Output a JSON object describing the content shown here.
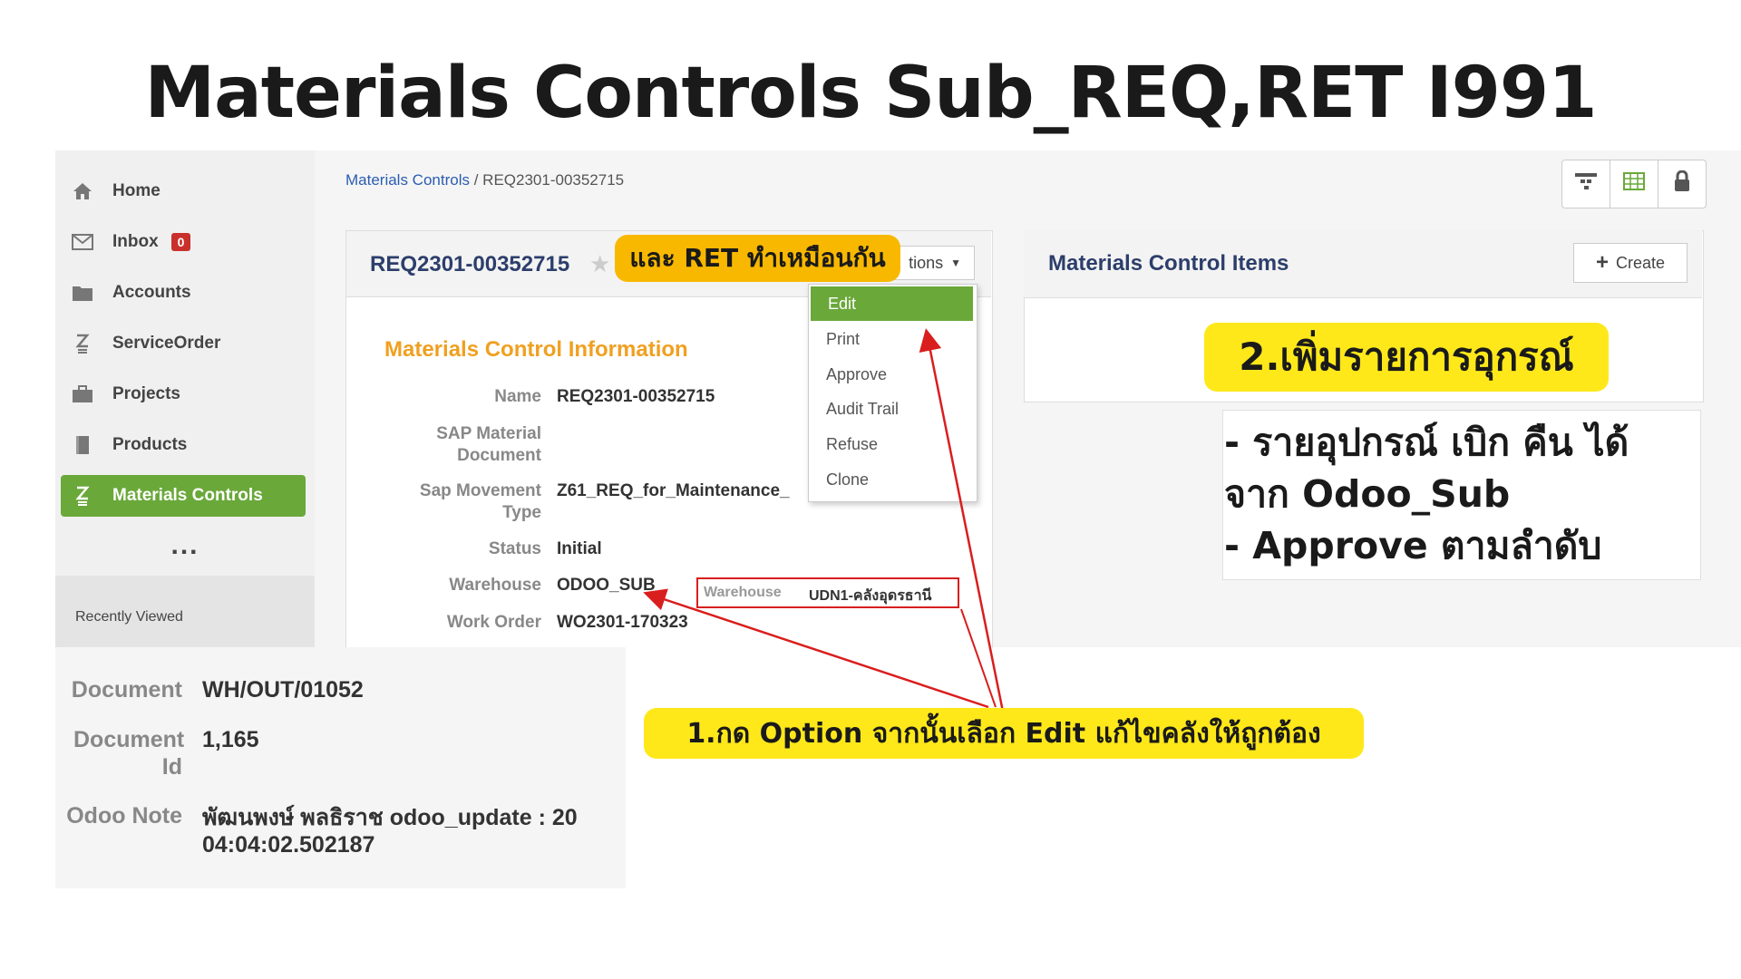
{
  "slide_title": "Materials Controls Sub_REQ,RET I991",
  "sidebar": {
    "items": [
      {
        "label": "Home",
        "icon": "home-icon"
      },
      {
        "label": "Inbox",
        "icon": "envelope-icon",
        "badge": "0"
      },
      {
        "label": "Accounts",
        "icon": "folder-icon"
      },
      {
        "label": "ServiceOrder",
        "icon": "z-icon"
      },
      {
        "label": "Projects",
        "icon": "briefcase-icon"
      },
      {
        "label": "Products",
        "icon": "book-icon"
      },
      {
        "label": "Materials Controls",
        "icon": "z-icon",
        "active": true
      }
    ],
    "more": "...",
    "recently_viewed": "Recently Viewed"
  },
  "breadcrumb": {
    "parent": "Materials Controls",
    "separator": " / ",
    "current": "REQ2301-00352715"
  },
  "toolbar_icons": [
    "hierarchy-icon",
    "grid-icon",
    "lock-icon"
  ],
  "record": {
    "title": "REQ2301-00352715",
    "options_label": "tions",
    "options_menu": [
      "Edit",
      "Print",
      "Approve",
      "Audit Trail",
      "Refuse",
      "Clone"
    ],
    "section_title": "Materials Control Information",
    "fields": [
      {
        "label": "Name",
        "value": "REQ2301-00352715"
      },
      {
        "label": "SAP Material Document",
        "value": ""
      },
      {
        "label": "Sap Movement Type",
        "value": "Z61_REQ_for_Maintenance_"
      },
      {
        "label": "Status",
        "value": "Initial"
      },
      {
        "label": "Warehouse",
        "value": "ODOO_SUB"
      },
      {
        "label": "Work Order",
        "value": "WO2301-170323"
      }
    ],
    "warehouse_highlight": {
      "label": "Warehouse",
      "value": "UDN1-คลังอุดรธานี"
    }
  },
  "items_panel": {
    "title": "Materials Control Items",
    "create_label": "Create"
  },
  "document_panel": [
    {
      "label": "Document",
      "value": "WH/OUT/01052"
    },
    {
      "label": "Document Id",
      "value": "1,165"
    },
    {
      "label": "Odoo Note",
      "value": "พัฒนพงษ์ พลธิราช odoo_update : 20",
      "value2": "04:04:02.502187"
    }
  ],
  "callouts": {
    "same_for_ret": "และ RET ทำเหมือนกัน",
    "step1": "1.กด Option จากนั้นเลือก Edit แก้ไขคลังให้ถูกต้อง",
    "step2": "2.เพิ่มรายการอุกรณ์",
    "notes": [
      "- รายอุปกรณ์ เบิก คืน ได้",
      "จาก Odoo_Sub",
      "- Approve ตามลำดับ"
    ]
  },
  "colors": {
    "accent_green": "#6aa83a",
    "callout_yellow": "#ffe81a",
    "callout_orange": "#f9b800",
    "arrow_red": "#d91e1e",
    "section_orange": "#f0a020",
    "title_navy": "#2c3e6b"
  }
}
